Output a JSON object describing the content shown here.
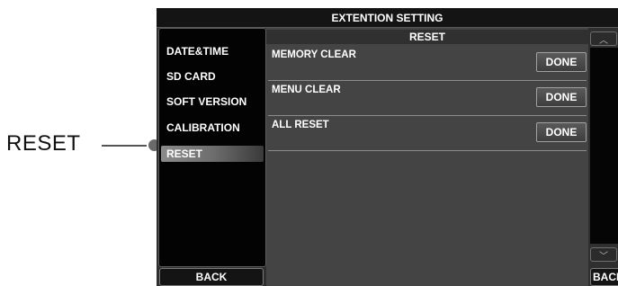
{
  "callout": {
    "label": "RESET"
  },
  "window": {
    "title": "EXTENTION SETTING"
  },
  "sidebar": {
    "items": [
      {
        "label": "DATE&TIME"
      },
      {
        "label": "SD CARD"
      },
      {
        "label": "SOFT VERSION"
      },
      {
        "label": "CALIBRATION"
      },
      {
        "label": "RESET",
        "selected": true
      }
    ],
    "back_label": "BACK"
  },
  "panel": {
    "header": "RESET",
    "rows": [
      {
        "label": "MEMORY CLEAR",
        "button": "DONE"
      },
      {
        "label": "MENU CLEAR",
        "button": "DONE"
      },
      {
        "label": "ALL RESET",
        "button": "DONE"
      }
    ]
  },
  "scroll": {
    "up_icon": "chevron-up-icon",
    "down_icon": "chevron-down-icon",
    "up_glyph": "︿",
    "down_glyph": "﹀"
  },
  "footer": {
    "back_label": "BACK"
  },
  "colors": {
    "background": "#2f2f2f",
    "sidebar": "#030303",
    "panel": "#444444",
    "selected_gradient": "#8a8a8a"
  }
}
